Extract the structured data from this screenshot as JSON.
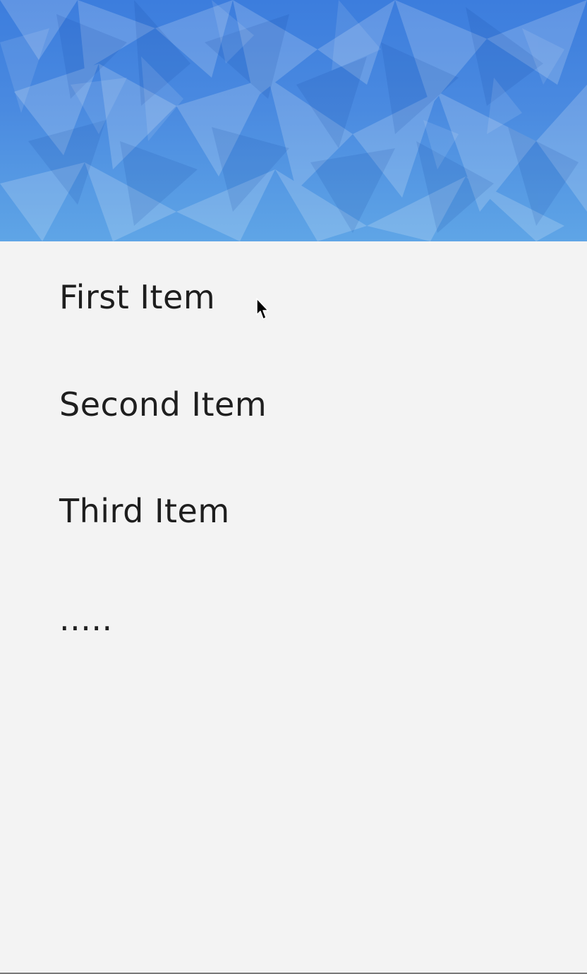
{
  "drawer": {
    "header": {
      "background_colors": [
        "#3c7ddd",
        "#5fa5e6"
      ],
      "pattern": "low-poly"
    },
    "items": [
      {
        "label": "First Item"
      },
      {
        "label": "Second Item"
      },
      {
        "label": "Third Item"
      },
      {
        "label": "....."
      }
    ]
  },
  "cursor": {
    "icon": "mouse-pointer-icon"
  }
}
